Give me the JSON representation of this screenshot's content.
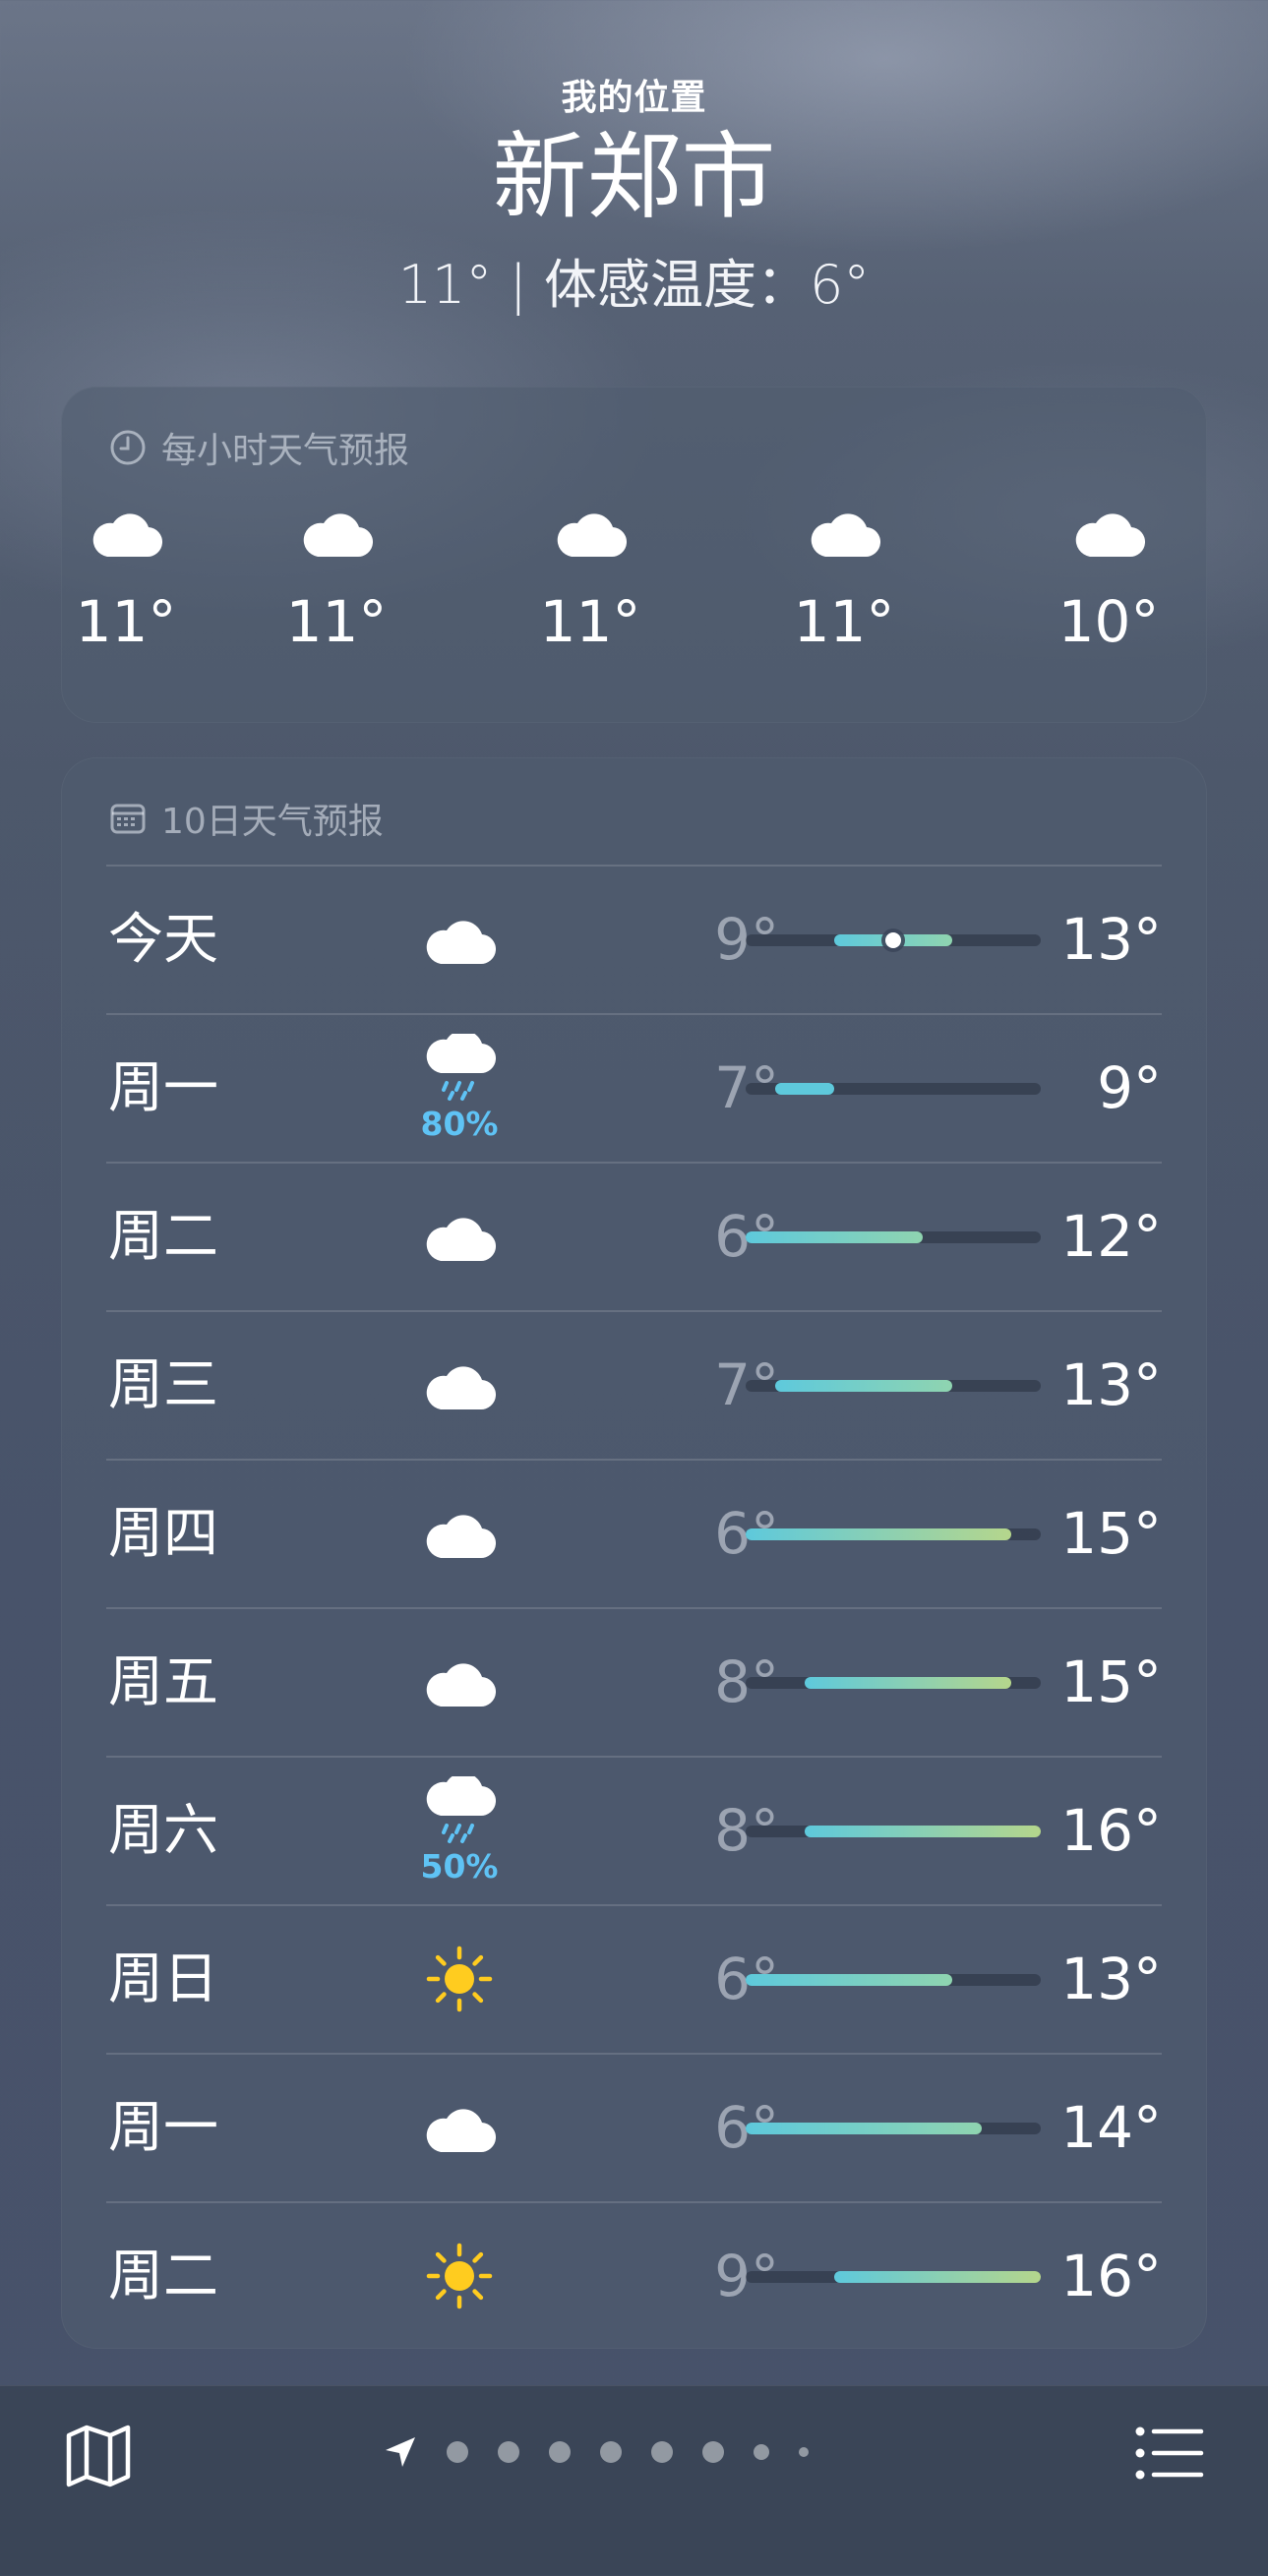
{
  "header": {
    "location_label": "我的位置",
    "city": "新郑市",
    "current_line": "11° | 体感温度：6°"
  },
  "hourly": {
    "title": "每小时天气预报",
    "icon": "clock-icon",
    "hours": [
      {
        "icon": "cloud-icon",
        "temp": "11°"
      },
      {
        "icon": "cloud-icon",
        "temp": "11°"
      },
      {
        "icon": "cloud-icon",
        "temp": "11°"
      },
      {
        "icon": "cloud-icon",
        "temp": "11°"
      },
      {
        "icon": "cloud-icon",
        "temp": "10°"
      }
    ]
  },
  "daily": {
    "title": "10日天气预报",
    "icon": "calendar-icon",
    "range_min": 6,
    "range_max": 16,
    "days": [
      {
        "name": "今天",
        "icon": "cloud-icon",
        "precip": "",
        "low": "9°",
        "high": "13°",
        "low_v": 9,
        "high_v": 13,
        "current_v": 11
      },
      {
        "name": "周一",
        "icon": "cloud-rain-icon",
        "precip": "80%",
        "low": "7°",
        "high": "9°",
        "low_v": 7,
        "high_v": 9
      },
      {
        "name": "周二",
        "icon": "cloud-icon",
        "precip": "",
        "low": "6°",
        "high": "12°",
        "low_v": 6,
        "high_v": 12
      },
      {
        "name": "周三",
        "icon": "cloud-icon",
        "precip": "",
        "low": "7°",
        "high": "13°",
        "low_v": 7,
        "high_v": 13
      },
      {
        "name": "周四",
        "icon": "cloud-icon",
        "precip": "",
        "low": "6°",
        "high": "15°",
        "low_v": 6,
        "high_v": 15
      },
      {
        "name": "周五",
        "icon": "cloud-icon",
        "precip": "",
        "low": "8°",
        "high": "15°",
        "low_v": 8,
        "high_v": 15
      },
      {
        "name": "周六",
        "icon": "cloud-rain-icon",
        "precip": "50%",
        "low": "8°",
        "high": "16°",
        "low_v": 8,
        "high_v": 16
      },
      {
        "name": "周日",
        "icon": "sun-icon",
        "precip": "",
        "low": "6°",
        "high": "13°",
        "low_v": 6,
        "high_v": 13
      },
      {
        "name": "周一",
        "icon": "cloud-icon",
        "precip": "",
        "low": "6°",
        "high": "14°",
        "low_v": 6,
        "high_v": 14
      },
      {
        "name": "周二",
        "icon": "sun-icon",
        "precip": "",
        "low": "9°",
        "high": "16°",
        "low_v": 9,
        "high_v": 16
      }
    ]
  },
  "toolbar": {
    "map_icon": "map-icon",
    "list_icon": "list-icon",
    "location_icon": "location-arrow-icon",
    "page_count": 9,
    "current_page": 0
  },
  "colors": {
    "cool": "#5ec9dc",
    "mild": "#8fd4b0",
    "warm": "#b5d68c",
    "precip": "#5fc3f5",
    "sun": "#ffcc1f"
  }
}
